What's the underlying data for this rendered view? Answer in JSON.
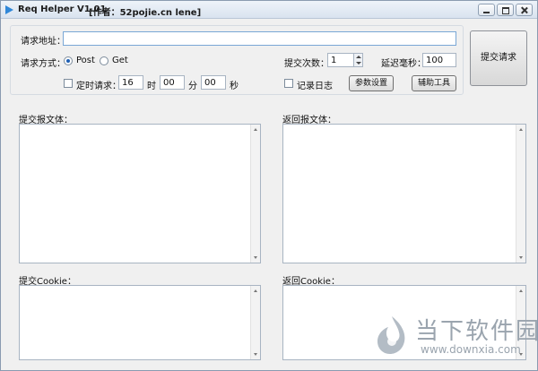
{
  "window": {
    "title": "Req Helper V1.01",
    "author": "[作者：52pojie.cn lene]"
  },
  "form": {
    "url_label": "请求地址：",
    "url_value": "",
    "method_label": "请求方式：",
    "method_options": [
      "Post",
      "Get"
    ],
    "method_selected": "Post",
    "submit_count_label": "提交次数：",
    "submit_count_value": "1",
    "delay_label": "延迟毫秒：",
    "delay_value": "100",
    "timer_label": "定时请求：",
    "timer_checked": false,
    "timer_hour": "16",
    "hour_unit": "时",
    "timer_minute": "00",
    "minute_unit": "分",
    "timer_second": "00",
    "second_unit": "秒",
    "log_label": "记录日志",
    "log_checked": false,
    "param_button": "参数设置",
    "tools_button": "辅助工具",
    "submit_button": "提交请求"
  },
  "panels": {
    "submit_body_label": "提交报文体：",
    "return_body_label": "返回报文体：",
    "submit_cookie_label": "提交Cookie：",
    "return_cookie_label": "返回Cookie："
  },
  "watermark": {
    "title": "当下软件园",
    "url": "www.downxia.com"
  },
  "colors": {
    "accent": "#2f87d8",
    "window_bg": "#f0f0f0",
    "watermark": "#9aa4ae"
  }
}
